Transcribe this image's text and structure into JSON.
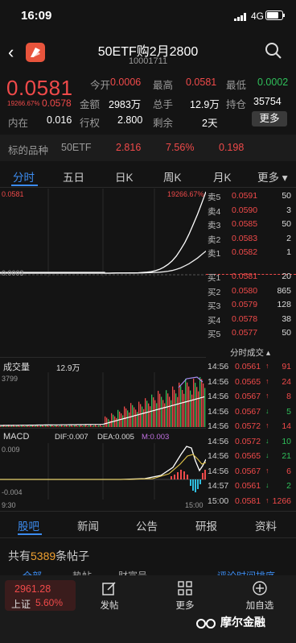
{
  "status_bar": {
    "time": "16:09",
    "network": "4G"
  },
  "header": {
    "title": "50ETF购2月2800",
    "code": "10001711"
  },
  "quote": {
    "price": "0.0581",
    "pct_change": "19266.67%",
    "change": "0.0578",
    "rows": [
      {
        "label": "今开",
        "value": "0.0006"
      },
      {
        "label": "最高",
        "value": "0.0581"
      },
      {
        "label": "最低",
        "value": "0.0002"
      },
      {
        "label": "金额",
        "value": "2983万"
      },
      {
        "label": "总手",
        "value": "12.9万"
      },
      {
        "label": "持仓",
        "value": "35754"
      },
      {
        "label": "内在",
        "value": "0.016"
      },
      {
        "label": "行权",
        "value": "2.800"
      },
      {
        "label": "剩余",
        "value": "2天"
      }
    ],
    "more_label": "更多"
  },
  "underlying": {
    "label": "标的品种",
    "name": "50ETF",
    "price": "2.816",
    "pct": "7.56%",
    "change": "0.198"
  },
  "tabs": [
    "分时",
    "五日",
    "日K",
    "周K",
    "月K",
    "更多"
  ],
  "chart": {
    "price_max": "0.0581",
    "pct_max": "19266.67%",
    "price_min": "0.0003",
    "volume_label": "成交量",
    "volume_total": "12.9万",
    "volume_max": "3799",
    "macd_label": "MACD",
    "dif": "DIF:0.007",
    "dea": "DEA:0.005",
    "m": "M:0.003",
    "macd_top": "0.009",
    "macd_bottom": "-0.004",
    "time_start": "9:30",
    "time_end": "15:00"
  },
  "chart_data": {
    "type": "line",
    "title": "",
    "x_range": [
      "9:30",
      "15:00"
    ],
    "price_series": [
      0.0003,
      0.0003,
      0.0004,
      0.0004,
      0.0004,
      0.0004,
      0.0005,
      0.0005,
      0.0006,
      0.0008,
      0.001,
      0.0014,
      0.002,
      0.003,
      0.0045,
      0.0065,
      0.009,
      0.0125,
      0.017,
      0.022,
      0.028,
      0.035,
      0.042,
      0.05,
      0.0581
    ],
    "avg_series": [
      0.0003,
      0.0003,
      0.0003,
      0.0004,
      0.0004,
      0.0004,
      0.0004,
      0.0004,
      0.0005,
      0.0005,
      0.0006,
      0.0007,
      0.0008,
      0.001,
      0.0013,
      0.0017,
      0.0022,
      0.003,
      0.004,
      0.0055,
      0.007,
      0.009,
      0.011,
      0.0135,
      0.016
    ],
    "ylim": [
      0.0003,
      0.0581
    ],
    "volume_max": 3799
  },
  "order_book": {
    "asks": [
      {
        "label": "卖5",
        "price": "0.0591",
        "vol": "50"
      },
      {
        "label": "卖4",
        "price": "0.0590",
        "vol": "3"
      },
      {
        "label": "卖3",
        "price": "0.0585",
        "vol": "50"
      },
      {
        "label": "卖2",
        "price": "0.0583",
        "vol": "2"
      },
      {
        "label": "卖1",
        "price": "0.0582",
        "vol": "1"
      }
    ],
    "bids": [
      {
        "label": "买1",
        "price": "0.0581",
        "vol": "20"
      },
      {
        "label": "买2",
        "price": "0.0580",
        "vol": "865"
      },
      {
        "label": "买3",
        "price": "0.0579",
        "vol": "128"
      },
      {
        "label": "买4",
        "price": "0.0578",
        "vol": "38"
      },
      {
        "label": "买5",
        "price": "0.0577",
        "vol": "50"
      }
    ],
    "ticks_title": "分时成交",
    "ticks": [
      {
        "time": "14:56",
        "price": "0.0561",
        "vol": "91",
        "dir": "up"
      },
      {
        "time": "14:56",
        "price": "0.0565",
        "vol": "24",
        "dir": "up"
      },
      {
        "time": "14:56",
        "price": "0.0567",
        "vol": "8",
        "dir": "up"
      },
      {
        "time": "14:56",
        "price": "0.0567",
        "vol": "5",
        "dir": "down"
      },
      {
        "time": "14:56",
        "price": "0.0572",
        "vol": "14",
        "dir": "up"
      },
      {
        "time": "14:56",
        "price": "0.0572",
        "vol": "10",
        "dir": "down"
      },
      {
        "time": "14:56",
        "price": "0.0565",
        "vol": "21",
        "dir": "down"
      },
      {
        "time": "14:56",
        "price": "0.0567",
        "vol": "6",
        "dir": "up"
      },
      {
        "time": "14:57",
        "price": "0.0561",
        "vol": "2",
        "dir": "down"
      },
      {
        "time": "15:00",
        "price": "0.0581",
        "vol": "1266",
        "dir": "up"
      }
    ]
  },
  "bottom_tabs": [
    "股吧",
    "新闻",
    "公告",
    "研报",
    "资料"
  ],
  "posts": {
    "prefix": "共有",
    "count": "5389",
    "suffix": "条帖子"
  },
  "sub_tabs": [
    "全部",
    "热帖",
    "财富号",
    "评论时间排序"
  ],
  "footer": {
    "index_value": "2961.28",
    "index_name": "上证",
    "index_pct": "5.60%",
    "post_label": "发帖",
    "more_label": "更多",
    "add_label": "加自选",
    "watermark": "摩尔金融"
  },
  "colors": {
    "up": "#f04a4a",
    "down": "#2fbf5a",
    "accent": "#3c8cf0",
    "bg": "#141414"
  }
}
